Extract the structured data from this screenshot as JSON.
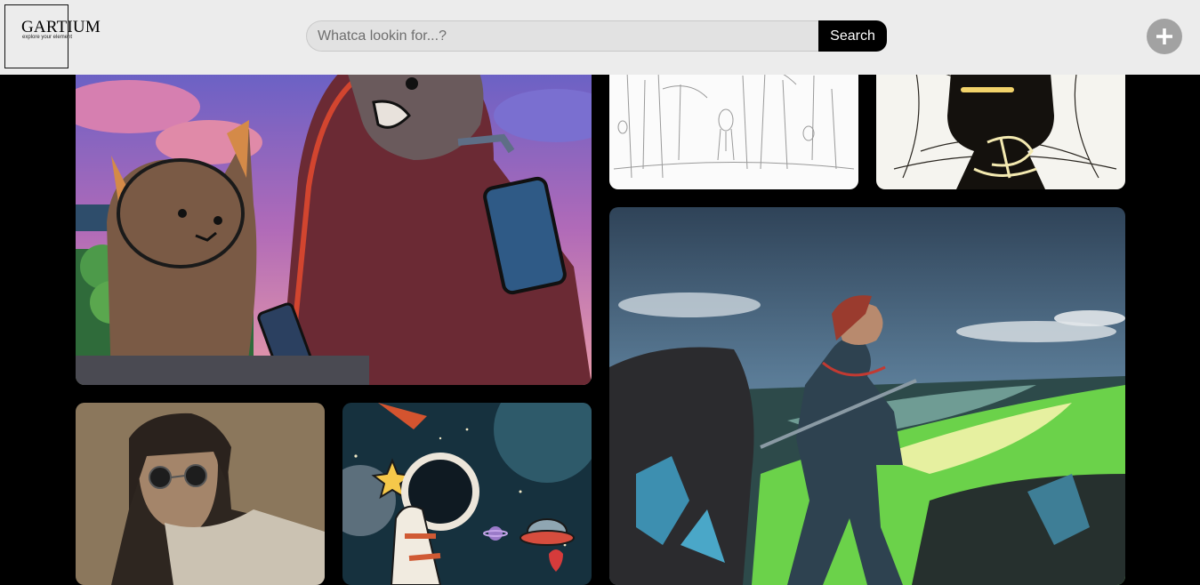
{
  "header": {
    "logo_title": "GARTIUM",
    "logo_tagline": "explore your element",
    "search": {
      "placeholder": "Whatca lookin for...?",
      "value": "",
      "button_label": "Search"
    },
    "add_icon": "plus-icon"
  },
  "gallery": {
    "items": [
      {
        "name": "cat-hoodie-drink-artwork"
      },
      {
        "name": "forest-sketch-artwork"
      },
      {
        "name": "dark-figure-sketch-artwork"
      },
      {
        "name": "knight-coast-artwork"
      },
      {
        "name": "goggles-portrait-artwork"
      },
      {
        "name": "astronaut-space-artwork"
      }
    ]
  }
}
